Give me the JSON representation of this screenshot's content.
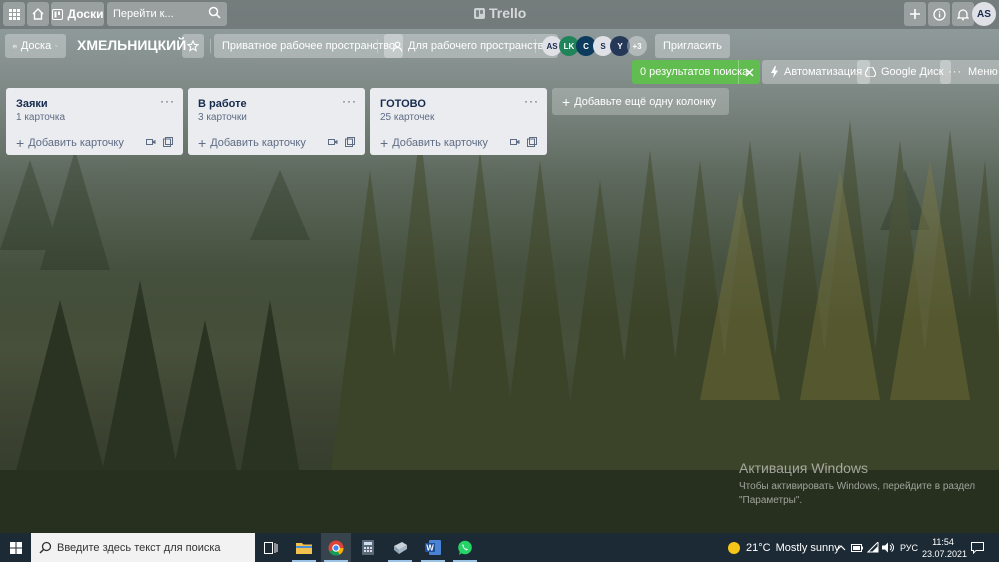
{
  "topbar": {
    "boards_label": "Доски",
    "search_placeholder": "Перейти к...",
    "logo_text": "Trello",
    "user_initials": "AS"
  },
  "board": {
    "view_label": "Доска",
    "title": "ХМЕЛЬНИЦКИЙ",
    "visibility_label": "Приватное рабочее пространство",
    "workspace_label": "Для рабочего пространства",
    "members": [
      {
        "initials": "AS",
        "color": "#dfe1e6",
        "text": "#172b4d"
      },
      {
        "initials": "LK",
        "color": "#1f845a",
        "text": "#ffffff"
      },
      {
        "initials": "C",
        "color": "#0c3b5e",
        "text": "#ffffff"
      },
      {
        "initials": "S",
        "color": "#dfe1e6",
        "text": "#172b4d"
      },
      {
        "initials": "Y",
        "color": "#253858",
        "text": "#ffffff"
      }
    ],
    "more_members": "+3",
    "invite_label": "Пригласить",
    "search_results_label": "0 результатов поиска",
    "automation_label": "Автоматизация",
    "google_drive_label": "Google Диск",
    "menu_label": "Меню"
  },
  "lists": [
    {
      "title": "Заяки",
      "count": "1 карточка",
      "add_label": "Добавить карточку"
    },
    {
      "title": "В работе",
      "count": "3 карточки",
      "add_label": "Добавить карточку"
    },
    {
      "title": "ГОТОВО",
      "count": "25 карточек",
      "add_label": "Добавить карточку"
    }
  ],
  "add_column_label": "Добавьте ещё одну колонку",
  "windows_activation": {
    "title": "Активация Windows",
    "subtitle_line1": "Чтобы активировать Windows, перейдите в раздел",
    "subtitle_line2": "\"Параметры\"."
  },
  "taskbar": {
    "search_placeholder": "Введите здесь текст для поиска",
    "weather_temp": "21°C",
    "weather_desc": "Mostly sunny",
    "language": "РУС",
    "time": "11:54",
    "date": "23.07.2021"
  },
  "colors": {
    "search_results_bg": "#61bd4f",
    "list_bg": "#ebecf0",
    "taskbar_bg": "#1c2a35"
  }
}
